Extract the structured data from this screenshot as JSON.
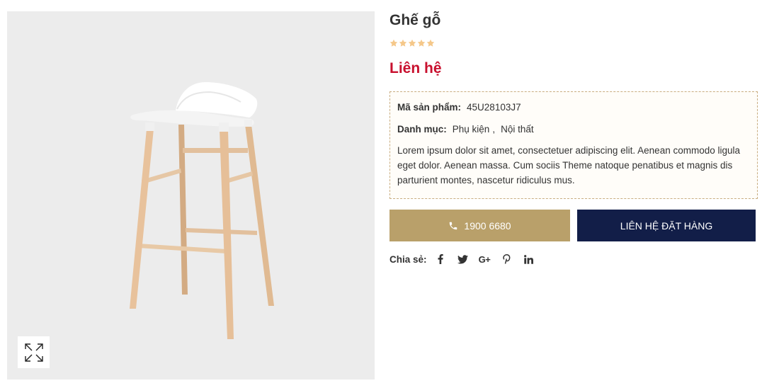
{
  "product": {
    "title": "Ghế gỗ",
    "rating": 5,
    "rating_max": 5,
    "price": "Liên hệ",
    "sku_label": "Mã sản phẩm:",
    "sku": "45U28103J7",
    "category_label": "Danh mục:",
    "categories": [
      "Phụ kiện",
      "Nội thất"
    ],
    "category_separator": ",",
    "description": "Lorem ipsum dolor sit amet, consectetuer adipiscing elit. Aenean commodo ligula eget dolor. Aenean massa. Cum sociis Theme natoque penatibus et magnis dis parturient montes, nascetur ridiculus mus."
  },
  "gallery": {
    "zoom_icon": "expand-arrows-icon"
  },
  "actions": {
    "phone_icon": "phone-icon",
    "phone_label": "1900 6680",
    "order_label": "LIÊN HỆ ĐẶT HÀNG"
  },
  "share": {
    "label": "Chia sẻ:",
    "icons": [
      "facebook-icon",
      "twitter-icon",
      "google-plus-icon",
      "pinterest-icon",
      "linkedin-icon"
    ],
    "google_plus_text": "G+"
  },
  "colors": {
    "price": "#c8102e",
    "star": "#f5c88a",
    "phone_button": "#b9a06a",
    "order_button": "#121e48",
    "box_border": "#c9ad80",
    "gallery_bg": "#ececec"
  }
}
